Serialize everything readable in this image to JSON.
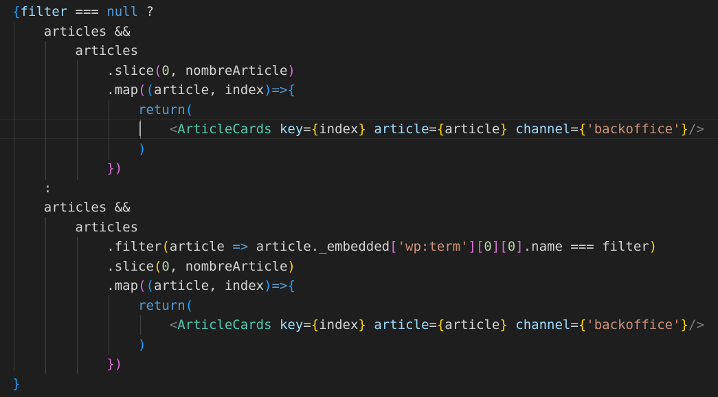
{
  "editor": {
    "theme_colors": {
      "background": "#1e1e1e",
      "variable": "#9cdcfe",
      "keyword": "#569cd6",
      "function": "#dcdcaa",
      "string": "#ce9178",
      "number": "#b5cea8",
      "component": "#4ec9b0",
      "bracket_level_1": "#ffd700",
      "bracket_level_2": "#da70d6",
      "bracket_level_3": "#179fff"
    },
    "current_line": 7,
    "lines": [
      [
        [
          "{",
          "b3"
        ],
        [
          "filter",
          "var"
        ],
        [
          " === ",
          "plain"
        ],
        [
          "null",
          "const"
        ],
        [
          " ?",
          "plain"
        ]
      ],
      [
        [
          "    articles &&",
          "plain"
        ]
      ],
      [
        [
          "        articles",
          "plain"
        ]
      ],
      [
        [
          "            .slice",
          "plain"
        ],
        [
          "(",
          "b2"
        ],
        [
          "0",
          "num"
        ],
        [
          ", nombreArticle",
          "plain"
        ],
        [
          ")",
          "b2"
        ]
      ],
      [
        [
          "            .map",
          "plain"
        ],
        [
          "(",
          "b2"
        ],
        [
          "(",
          "b3"
        ],
        [
          "article, index",
          "plain"
        ],
        [
          ")",
          "b3"
        ],
        [
          "=>",
          "const"
        ],
        [
          "{",
          "b3"
        ]
      ],
      [
        [
          "                return",
          "kw"
        ],
        [
          "(",
          "b3"
        ]
      ],
      [
        [
          "                    ",
          "plain"
        ],
        [
          "<",
          "tagp"
        ],
        [
          "ArticleCards",
          "tag"
        ],
        [
          " ",
          "plain"
        ],
        [
          "key",
          "attr"
        ],
        [
          "=",
          "plain"
        ],
        [
          "{",
          "b1"
        ],
        [
          "index",
          "plain"
        ],
        [
          "}",
          "b1"
        ],
        [
          " ",
          "plain"
        ],
        [
          "article",
          "attr"
        ],
        [
          "=",
          "plain"
        ],
        [
          "{",
          "b1"
        ],
        [
          "article",
          "plain"
        ],
        [
          "}",
          "b1"
        ],
        [
          " ",
          "plain"
        ],
        [
          "channel",
          "attr"
        ],
        [
          "=",
          "plain"
        ],
        [
          "{",
          "b1"
        ],
        [
          "'backoffice'",
          "str"
        ],
        [
          "}",
          "b1"
        ],
        [
          "/>",
          "tagp"
        ]
      ],
      [
        [
          "                )",
          "b3"
        ]
      ],
      [
        [
          "            })",
          "b2"
        ]
      ],
      [
        [
          "    :",
          "plain"
        ]
      ],
      [
        [
          "    articles &&",
          "plain"
        ]
      ],
      [
        [
          "        articles",
          "plain"
        ]
      ],
      [
        [
          "            .filter",
          "plain"
        ],
        [
          "(",
          "b1"
        ],
        [
          "article ",
          "plain"
        ],
        [
          "=>",
          "const"
        ],
        [
          " article._embedded",
          "plain"
        ],
        [
          "[",
          "b2"
        ],
        [
          "'wp:term'",
          "str"
        ],
        [
          "]",
          "b2"
        ],
        [
          "[",
          "b2"
        ],
        [
          "0",
          "num"
        ],
        [
          "]",
          "b2"
        ],
        [
          "[",
          "b2"
        ],
        [
          "0",
          "num"
        ],
        [
          "]",
          "b2"
        ],
        [
          ".name === filter",
          "plain"
        ],
        [
          ")",
          "b1"
        ]
      ],
      [
        [
          "            .slice",
          "plain"
        ],
        [
          "(",
          "b1"
        ],
        [
          "0",
          "num"
        ],
        [
          ", nombreArticle",
          "plain"
        ],
        [
          ")",
          "b1"
        ]
      ],
      [
        [
          "            .map",
          "plain"
        ],
        [
          "(",
          "b2"
        ],
        [
          "(",
          "b3"
        ],
        [
          "article, index",
          "plain"
        ],
        [
          ")",
          "b3"
        ],
        [
          "=>",
          "const"
        ],
        [
          "{",
          "b3"
        ]
      ],
      [
        [
          "                return",
          "kw"
        ],
        [
          "(",
          "b3"
        ]
      ],
      [
        [
          "                    ",
          "plain"
        ],
        [
          "<",
          "tagp"
        ],
        [
          "ArticleCards",
          "tag"
        ],
        [
          " ",
          "plain"
        ],
        [
          "key",
          "attr"
        ],
        [
          "=",
          "plain"
        ],
        [
          "{",
          "b1"
        ],
        [
          "index",
          "plain"
        ],
        [
          "}",
          "b1"
        ],
        [
          " ",
          "plain"
        ],
        [
          "article",
          "attr"
        ],
        [
          "=",
          "plain"
        ],
        [
          "{",
          "b1"
        ],
        [
          "article",
          "plain"
        ],
        [
          "}",
          "b1"
        ],
        [
          " ",
          "plain"
        ],
        [
          "channel",
          "attr"
        ],
        [
          "=",
          "plain"
        ],
        [
          "{",
          "b1"
        ],
        [
          "'backoffice'",
          "str"
        ],
        [
          "}",
          "b1"
        ],
        [
          "/>",
          "tagp"
        ]
      ],
      [
        [
          "                )",
          "b3"
        ]
      ],
      [
        [
          "            })",
          "b2"
        ]
      ],
      [
        [
          "}",
          "b3"
        ]
      ]
    ]
  }
}
